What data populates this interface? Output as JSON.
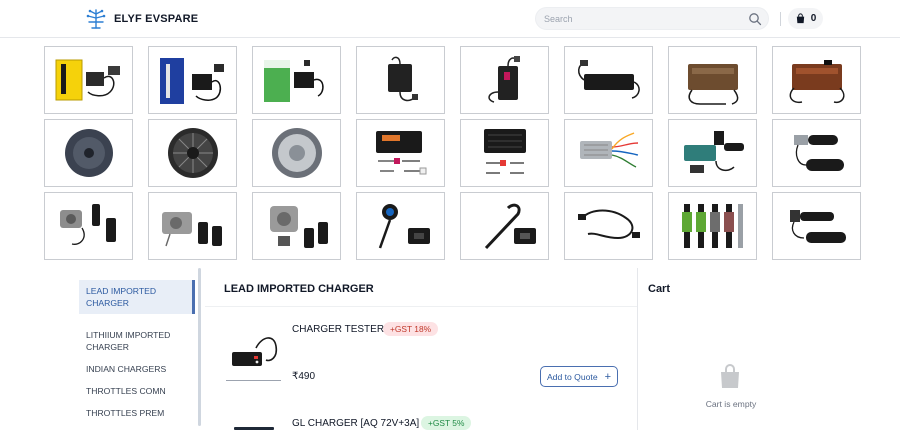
{
  "header": {
    "brand": "ELYF EVSPARE",
    "search_placeholder": "Search",
    "cart_count": "0"
  },
  "product_tiles": [
    {
      "icon": "yellow-ev-charger-image",
      "colors": [
        "#f5d20b",
        "#1a1a1a"
      ]
    },
    {
      "icon": "blue-ev-charger-box-image",
      "colors": [
        "#1f3fa0",
        "#111827"
      ]
    },
    {
      "icon": "green-charger-box-image",
      "colors": [
        "#4caf50",
        "#1a1a1a"
      ]
    },
    {
      "icon": "laptop-style-charger-image",
      "colors": [
        "#222222"
      ]
    },
    {
      "icon": "charger-with-cable-image",
      "colors": [
        "#222222",
        "#c2185b"
      ]
    },
    {
      "icon": "large-lithium-charger-image",
      "colors": [
        "#1a1a1a"
      ]
    },
    {
      "icon": "metal-charger-brown-image",
      "colors": [
        "#6d4c2f",
        "#1a1a1a"
      ]
    },
    {
      "icon": "metal-charger-orange-image",
      "colors": [
        "#7a3b1e",
        "#1a1a1a"
      ]
    },
    {
      "icon": "hub-motor-image",
      "colors": [
        "#3b4250"
      ]
    },
    {
      "icon": "spoked-hub-motor-image",
      "colors": [
        "#2b2b2b"
      ]
    },
    {
      "icon": "silver-hub-motor-image",
      "colors": [
        "#9aa0a6"
      ]
    },
    {
      "icon": "controller-with-wires-image",
      "colors": [
        "#1a1a1a",
        "#e0762b"
      ]
    },
    {
      "icon": "black-controller-image",
      "colors": [
        "#1a1a1a"
      ]
    },
    {
      "icon": "silver-controller-image",
      "colors": [
        "#b0b5ba",
        "#e53935"
      ]
    },
    {
      "icon": "throttle-controller-kit-image",
      "colors": [
        "#1a1a1a",
        "#2f7d7a"
      ]
    },
    {
      "icon": "throttle-grip-image",
      "colors": [
        "#1a1a1a",
        "#9aa0a6"
      ]
    },
    {
      "icon": "ignition-lock-set-image",
      "colors": [
        "#8d8d8d",
        "#1a1a1a"
      ]
    },
    {
      "icon": "lock-set-keys-image",
      "colors": [
        "#9a9a9a",
        "#1a1a1a"
      ]
    },
    {
      "icon": "key-switch-image",
      "colors": [
        "#9a9a9a",
        "#1a1a1a"
      ]
    },
    {
      "icon": "charging-port-image",
      "colors": [
        "#1a1a1a",
        "#1565c0"
      ]
    },
    {
      "icon": "socket-cable-image",
      "colors": [
        "#1a1a1a"
      ]
    },
    {
      "icon": "sensor-cable-image",
      "colors": [
        "#1a1a1a"
      ]
    },
    {
      "icon": "shock-absorbers-image",
      "colors": [
        "#5ea834",
        "#1a1a1a"
      ]
    },
    {
      "icon": "throttle-grip-pair-image",
      "colors": [
        "#1a1a1a"
      ]
    }
  ],
  "categories": [
    {
      "label": "LEAD IMPORTED CHARGER",
      "active": true
    },
    {
      "label": "LITHIIUM IMPORTED CHARGER",
      "active": false
    },
    {
      "label": "INDIAN CHARGERS",
      "active": false
    },
    {
      "label": "THROTTLES COMN",
      "active": false
    },
    {
      "label": "THROTTLES PREM",
      "active": false
    }
  ],
  "main": {
    "title": "LEAD IMPORTED CHARGER",
    "products": [
      {
        "name": "CHARGER TESTER",
        "badge": "+GST 18%",
        "price": "₹490",
        "button": "Add to Quote",
        "button_icon": "plus-icon"
      },
      {
        "name": "GL CHARGER [AQ 72V+3A]",
        "badge": "+GST 5%"
      }
    ]
  },
  "cart": {
    "title": "Cart",
    "empty_text": "Cart is empty"
  },
  "colors": {
    "accent": "#2c5aa0",
    "gst_red_bg": "#fde2e4",
    "gst_green_bg": "#dcf5e2"
  }
}
